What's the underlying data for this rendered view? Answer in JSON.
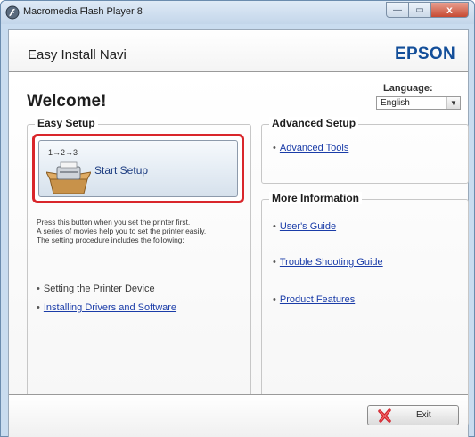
{
  "window": {
    "title": "Macromedia Flash Player 8",
    "controls": {
      "minimize": "—",
      "maximize": "▭",
      "close": "x"
    }
  },
  "header": {
    "app_title": "Easy Install Navi",
    "brand": "EPSON"
  },
  "main": {
    "welcome": "Welcome!",
    "language": {
      "label": "Language:",
      "selected": "English"
    }
  },
  "easy_setup": {
    "title": "Easy Setup",
    "setup_button": {
      "steps": "1→2→3",
      "label": "Start Setup"
    },
    "description": [
      "Press this button when you set the printer first.",
      "A series of movies help you to set the printer easily.",
      "The setting procedure includes the following:"
    ],
    "items": [
      {
        "label": "Setting the Printer Device",
        "link": false
      },
      {
        "label": "Installing Drivers and Software",
        "link": true
      }
    ]
  },
  "advanced_setup": {
    "title": "Advanced Setup",
    "links": [
      "Advanced Tools"
    ]
  },
  "more_information": {
    "title": "More Information",
    "links": [
      "User's Guide",
      "Trouble Shooting Guide",
      "Product Features"
    ]
  },
  "footer": {
    "exit_label": "Exit"
  },
  "colors": {
    "brand": "#134e99",
    "highlight": "#d9262b",
    "link": "#1a3ca8"
  },
  "icons": {
    "app": "flash-player-icon",
    "setup": "printer-box-icon",
    "exit": "red-x-icon"
  }
}
